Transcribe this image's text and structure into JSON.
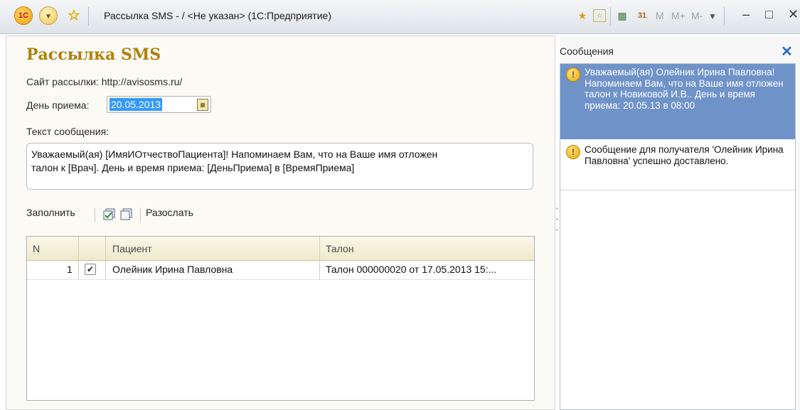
{
  "window": {
    "title": "Рассылка SMS - / <Не указан> (1С:Предприятие)",
    "logo_text": "1С",
    "toolbar_buttons": [
      "M",
      "M+",
      "M-"
    ]
  },
  "form": {
    "heading": "Рассылка SMS",
    "site_label": "Сайт рассылки: http://avisosms.ru/",
    "date_label": "День приема:",
    "date_value": "20.05.2013",
    "text_label": "Текст сообщения:",
    "message_text": "Уважаемый(ая) [ИмяИОтчествоПациента]! Напоминаем Вам, что на Ваше имя отложен\nталон к [Врач]. День и время приема: [ДеньПриема] в [ВремяПриема]",
    "toolbar": {
      "fill_label": "Заполнить",
      "send_label": "Разослать"
    },
    "table": {
      "columns": [
        "N",
        "Пациент",
        "Талон"
      ],
      "rows": [
        {
          "n": "1",
          "checked": true,
          "patient": "Олейник Ирина Павловна",
          "ticket": "Талон 000000020 от 17.05.2013 15:..."
        }
      ]
    }
  },
  "messages": {
    "title": "Сообщения",
    "close_icon": "✕",
    "items": [
      {
        "text": "Уважаемый(ая) Олейник Ирина Павловна! Напоминаем Вам, что на Ваше имя отложен талон к Новиковой И.В.. День и время приема: 20.05.13 в 08:00",
        "selected": true
      },
      {
        "text": "Сообщение для получателя 'Олейник Ирина Павловна' успешно доставлено.",
        "selected": false
      }
    ]
  },
  "colors": {
    "heading": "#b1800e",
    "selection": "#6f93c9",
    "accent_blue": "#2a6ad0"
  }
}
